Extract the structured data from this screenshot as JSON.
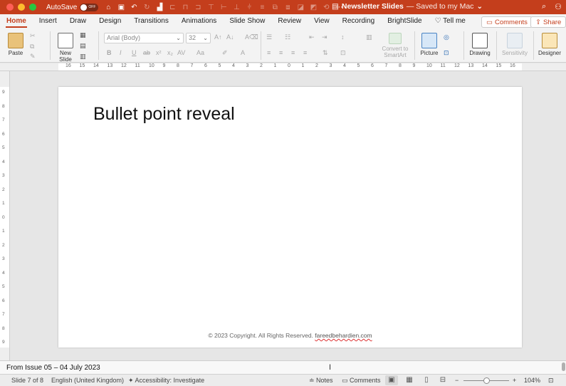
{
  "titlebar": {
    "autosave_label": "AutoSave",
    "autosave_state": "OFF",
    "doc_name": "Newsletter Slides",
    "doc_status": "— Saved to my Mac"
  },
  "tabs": [
    {
      "label": "Home"
    },
    {
      "label": "Insert"
    },
    {
      "label": "Draw"
    },
    {
      "label": "Design"
    },
    {
      "label": "Transitions"
    },
    {
      "label": "Animations"
    },
    {
      "label": "Slide Show"
    },
    {
      "label": "Review"
    },
    {
      "label": "View"
    },
    {
      "label": "Recording"
    },
    {
      "label": "BrightSlide"
    },
    {
      "label": "Tell me"
    }
  ],
  "tab_buttons": {
    "comments": "Comments",
    "share": "Share"
  },
  "ribbon": {
    "paste": "Paste",
    "new_slide_1": "New",
    "new_slide_2": "Slide",
    "font_name": "Arial (Body)",
    "font_size": "32",
    "convert_1": "Convert to",
    "convert_2": "SmartArt",
    "picture": "Picture",
    "drawing": "Drawing",
    "sensitivity": "Sensitivity",
    "designer": "Designer"
  },
  "ruler": {
    "h_ticks": [
      "16",
      "15",
      "14",
      "13",
      "12",
      "11",
      "10",
      "9",
      "8",
      "7",
      "6",
      "5",
      "4",
      "3",
      "2",
      "1",
      "0",
      "1",
      "2",
      "3",
      "4",
      "5",
      "6",
      "7",
      "8",
      "9",
      "10",
      "11",
      "12",
      "13",
      "14",
      "15",
      "16"
    ],
    "v_ticks": [
      "9",
      "8",
      "7",
      "6",
      "5",
      "4",
      "3",
      "2",
      "1",
      "0",
      "1",
      "2",
      "3",
      "4",
      "5",
      "6",
      "7",
      "8",
      "9"
    ]
  },
  "slide": {
    "title": "Bullet point reveal",
    "footer_text": "© 2023 Copyright. All Rights Reserved.",
    "footer_link": "fareedbehardien.com"
  },
  "notes": {
    "text": "From Issue 05 – 04 July 2023"
  },
  "status": {
    "slide_count": "Slide 7 of 8",
    "language": "English (United Kingdom)",
    "accessibility": "Accessibility: Investigate",
    "notes": "Notes",
    "comments": "Comments",
    "zoom": "104%"
  },
  "colors": {
    "accent": "#c43e1c"
  }
}
